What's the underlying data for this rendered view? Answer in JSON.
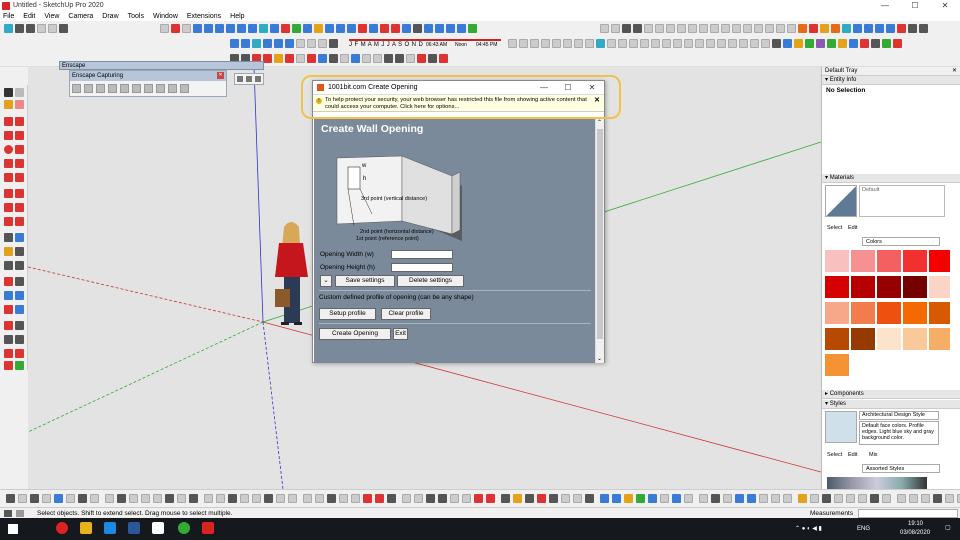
{
  "window": {
    "title": "Untitled - SketchUp Pro 2020"
  },
  "menu": [
    "File",
    "Edit",
    "View",
    "Camera",
    "Draw",
    "Tools",
    "Window",
    "Extensions",
    "Help"
  ],
  "shadow_toolbar": {
    "months": "J F M A M J J A S O N D",
    "time_start": "06:43 AM",
    "time_mid": "Noon",
    "time_end": "04:45 PM"
  },
  "enscape": {
    "panel_title": "Enscape",
    "capture_title": "Enscape Capturing"
  },
  "dialog": {
    "title": "1001bit.com Create Opening",
    "security_message": "To help protect your security, your web browser has restricted this file from showing active content that could access your computer. Click here for options...",
    "heading": "Create Wall Opening",
    "diagram_labels": {
      "w": "w",
      "h": "h",
      "third": "3rd point (vertical distance)",
      "second": "2nd point (horizontal distance)",
      "first": "1st point (reference point)"
    },
    "opening_width_label": "Opening Width (w)",
    "opening_height_label": "Opening Height (h)",
    "save_settings": "Save settings",
    "delete_settings": "Delete settings",
    "custom_profile_text": "Custom defined profile of opening (can be any shape)",
    "setup_profile": "Setup profile",
    "clear_profile": "Clear profile",
    "create_opening": "Create Opening",
    "exit": "Exit"
  },
  "tray": {
    "title": "Default Tray",
    "entity_info": "Entity Info",
    "no_selection": "No Selection",
    "materials": "Materials",
    "material_default": "Default",
    "select_tab": "Select",
    "edit_tab": "Edit",
    "colors_dropdown": "Colors",
    "components": "Components",
    "styles": "Styles",
    "style_name": "Architectural Design Style",
    "style_desc": "Default face colors. Profile edges. Light blue sky and gray background color.",
    "styles_select": "Select",
    "styles_edit": "Edit",
    "styles_mix": "Mix",
    "assorted_styles": "Assorted Styles",
    "swatch_colors": [
      "#f9c0c0",
      "#f79090",
      "#f46060",
      "#f23030",
      "#f50000",
      "#d50000",
      "#b50000",
      "#950000",
      "#750000",
      "#fad4c4",
      "#f6a888",
      "#f27c4c",
      "#ee5010",
      "#f56a00",
      "#d55a00",
      "#b54a00",
      "#953a00",
      "#fce4cc",
      "#f9c999",
      "#f6ae66",
      "#f39333"
    ]
  },
  "status": {
    "message": "Select objects. Shift to extend select. Drag mouse to select multiple.",
    "measurements_label": "Measurements"
  },
  "taskbar": {
    "lang": "ENG",
    "time": "19:10",
    "date": "03/08/2020"
  }
}
